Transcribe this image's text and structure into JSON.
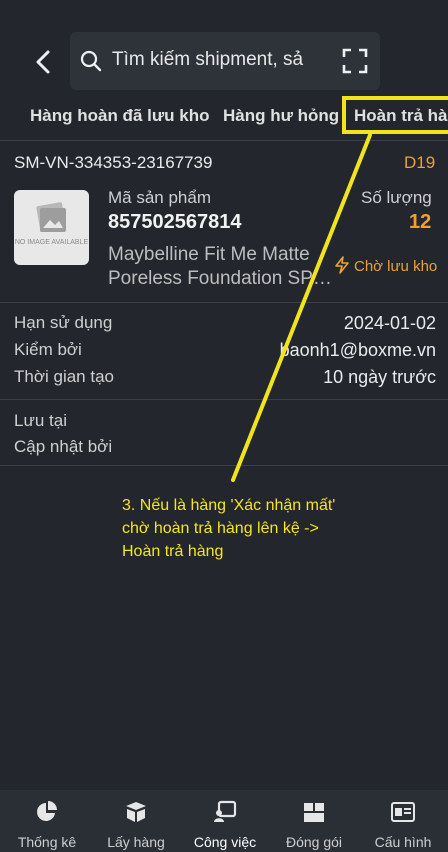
{
  "search": {
    "placeholder": "Tìm kiếm shipment, sả"
  },
  "tabs": [
    {
      "label": "Hàng hoàn đã lưu kho"
    },
    {
      "label": "Hàng hư hỏng"
    },
    {
      "label": "Hoàn trả hàn"
    }
  ],
  "item": {
    "shipment_code": "SM-VN-334353-23167739",
    "slot": "D19",
    "image_placeholder": "NO IMAGE AVAILABLE",
    "sku_label": "Mã sản phẩm",
    "sku_value": "857502567814",
    "qty_label": "Số lượng",
    "qty_value": "12",
    "product_name_line1": "Maybelline Fit Me Matte",
    "product_name_line2": "Poreless Foundation SP…",
    "status": "Chờ lưu kho",
    "details": [
      {
        "label": "Hạn sử dụng",
        "value": "2024-01-02"
      },
      {
        "label": "Kiểm bởi",
        "value": "baonh1@boxme.vn"
      },
      {
        "label": "Thời gian tạo",
        "value": "10 ngày trước"
      }
    ],
    "stored_at_label": "Lưu tại",
    "updated_by_label": "Cập nhật bởi"
  },
  "annotation": "3. Nếu là hàng 'Xác nhận mất' chờ hoàn trả hàng lên kệ -> Hoàn trả hàng",
  "colors": {
    "accent": "#f0a030",
    "annotation": "#f5e61a",
    "background": "#23272d"
  },
  "bottom_nav": [
    {
      "label": "Thống kê",
      "icon": "pie-chart-icon"
    },
    {
      "label": "Lấy hàng",
      "icon": "box-icon"
    },
    {
      "label": "Công việc",
      "icon": "task-board-icon"
    },
    {
      "label": "Đóng gói",
      "icon": "package-icon"
    },
    {
      "label": "Cấu hình",
      "icon": "id-card-icon"
    }
  ]
}
